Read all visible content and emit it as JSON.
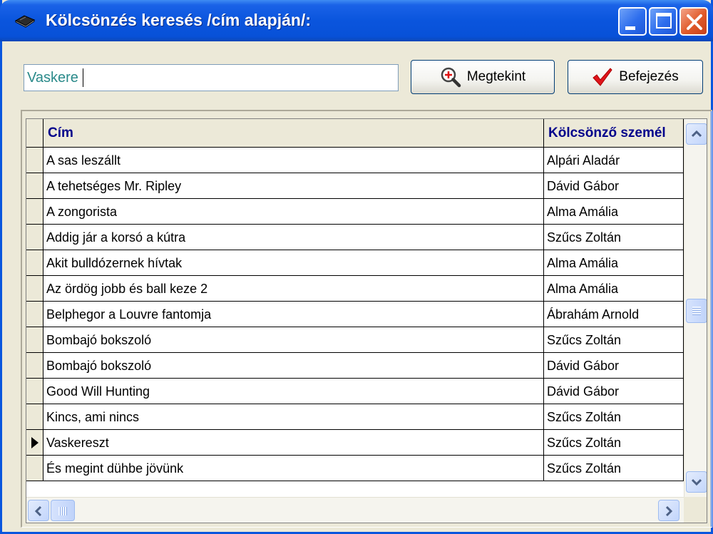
{
  "window": {
    "title": "Kölcsönzés keresés /cím alapján/:"
  },
  "search": {
    "value": "Vaskere"
  },
  "toolbar": {
    "view_label": "Megtekint",
    "finish_label": "Befejezés"
  },
  "grid": {
    "columns": [
      "Cím",
      "Kölcsönző személ"
    ],
    "current_row_index": 11,
    "rows": [
      {
        "title": "A sas leszállt",
        "person": "Alpári Aladár"
      },
      {
        "title": "A tehetséges Mr. Ripley",
        "person": "Dávid Gábor"
      },
      {
        "title": "A zongorista",
        "person": "Alma Amália"
      },
      {
        "title": "Addig jár a korsó a kútra",
        "person": "Szűcs Zoltán"
      },
      {
        "title": "Akit bulldózernek hívtak",
        "person": "Alma Amália"
      },
      {
        "title": "Az ördög jobb és ball keze 2",
        "person": "Alma Amália"
      },
      {
        "title": "Belphegor a Louvre fantomja",
        "person": "Ábrahám Arnold"
      },
      {
        "title": "Bombajó bokszoló",
        "person": "Szűcs Zoltán"
      },
      {
        "title": "Bombajó bokszoló",
        "person": "Dávid Gábor"
      },
      {
        "title": "Good Will Hunting",
        "person": "Dávid Gábor"
      },
      {
        "title": "Kincs, ami nincs",
        "person": "Szűcs Zoltán"
      },
      {
        "title": "Vaskereszt",
        "person": "Szűcs Zoltán"
      },
      {
        "title": "És megint dühbe jövünk",
        "person": "Szűcs Zoltán"
      }
    ]
  },
  "colors": {
    "title_bar": "#0a55dd",
    "header_text": "#00008b",
    "check": "#e0141b"
  },
  "icons": {
    "app": "book-icon",
    "view": "magnifier-icon",
    "finish": "checkmark-icon",
    "row_pointer": "triangle-right-icon"
  }
}
